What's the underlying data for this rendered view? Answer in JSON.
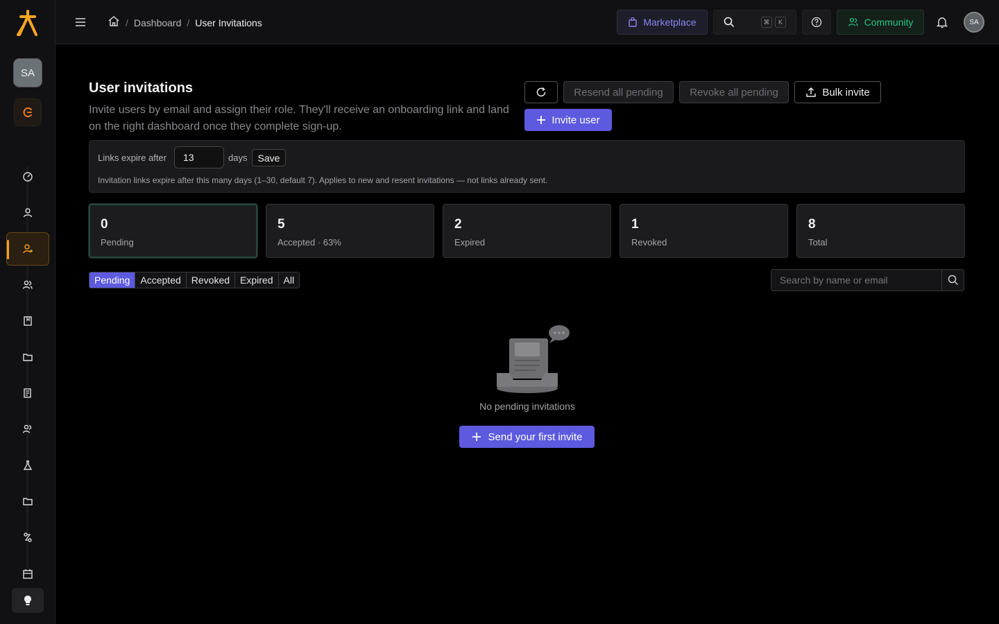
{
  "sidebar": {
    "avatar_initials": "SA",
    "nav_icons": [
      "dashboard-icon",
      "user-icon",
      "user-invite-icon",
      "users-icon",
      "book-icon",
      "folder-icon",
      "report-icon",
      "team-icon",
      "flask-icon",
      "folder-icon",
      "workflow-icon",
      "calendar-icon"
    ],
    "active_index": 2
  },
  "topbar": {
    "breadcrumb": {
      "parent": "Dashboard",
      "separator": "/",
      "current": "User Invitations"
    },
    "marketplace_label": "Marketplace",
    "kbd_cmd": "⌘",
    "kbd_key": "K",
    "community_label": "Community",
    "avatar_initials": "SA"
  },
  "page": {
    "title": "User invitations",
    "description": "Invite users by email and assign their role. They'll receive an onboarding link and land on the right dashboard once they complete sign-up.",
    "actions": {
      "resend_label": "Resend all pending",
      "revoke_label": "Revoke all pending",
      "bulk_label": "Bulk invite",
      "invite_label": "Invite user"
    }
  },
  "expiry": {
    "label": "Links expire after",
    "value": "13",
    "unit": "days",
    "save_label": "Save",
    "help": "Invitation links expire after this many days (1–30, default 7). Applies to new and resent invitations — not links already sent."
  },
  "stats": [
    {
      "value": "0",
      "label": "Pending"
    },
    {
      "value": "5",
      "label": "Accepted · 63%"
    },
    {
      "value": "2",
      "label": "Expired"
    },
    {
      "value": "1",
      "label": "Revoked"
    },
    {
      "value": "8",
      "label": "Total"
    }
  ],
  "filters": [
    "Pending",
    "Accepted",
    "Revoked",
    "Expired",
    "All"
  ],
  "search": {
    "placeholder": "Search by name or email"
  },
  "empty_state": {
    "message": "No pending invitations",
    "cta_label": "Send your first invite"
  },
  "colors": {
    "accent": "#5d5ae0",
    "sidebar_active": "#f0a020",
    "community": "#26c485",
    "marketplace": "#8b85f0"
  }
}
